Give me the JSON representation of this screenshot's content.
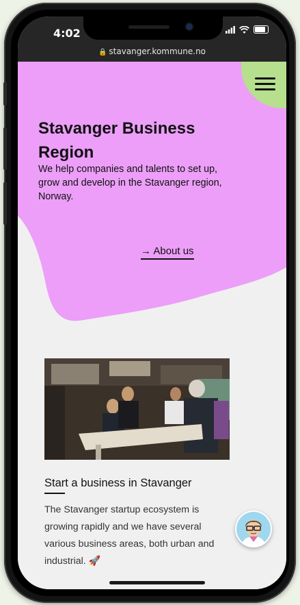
{
  "status_bar": {
    "time": "4:02",
    "url": "stavanger.kommune.no"
  },
  "hero": {
    "title": "Stavanger Business Region",
    "description": "We help companies and talents to set up, grow and develop in the Stavanger region, Norway.",
    "link_arrow": "→",
    "link_label": "About us"
  },
  "card": {
    "title": "Start a business in Stavanger",
    "text": "The Stavanger startup ecosystem is growing rapidly and we have several various business areas, both urban and industrial. 🚀"
  },
  "icons": [
    "lock-icon",
    "signal-icon",
    "wifi-icon",
    "battery-icon",
    "menu-icon",
    "chat-avatar-icon"
  ],
  "colors": {
    "hero_blob": "#ec9ef8",
    "menu_button": "#b6e08e",
    "page_bg": "#f0f0f0"
  }
}
